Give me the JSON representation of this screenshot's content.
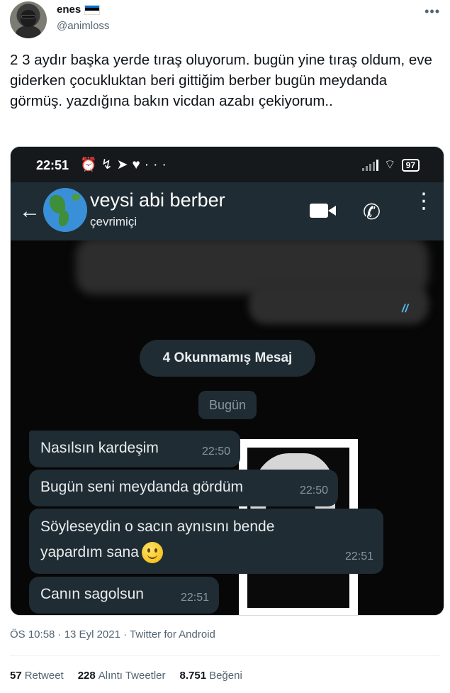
{
  "author": {
    "name": "enes",
    "handle": "@animloss",
    "flag_colors": [
      "#0072CE",
      "#000000",
      "#FFFFFF"
    ]
  },
  "tweet_text": "2 3 aydır başka yerde tıraş oluyorum. bugün yine tıraş oldum, eve giderken çocukluktan beri gittiğim berber bugün meydanda görmüş. yazdığına bakın vicdan azabı çekiyorum..",
  "phone": {
    "status_time": "22:51",
    "battery": "97"
  },
  "chat_header": {
    "contact_name": "veysi abi berber",
    "contact_status": "çevrimiçi"
  },
  "chat": {
    "unread_label": "4 Okunmamış Mesaj",
    "date_label": "Bugün",
    "messages": [
      {
        "text": "Nasılsın kardeşim",
        "time": "22:50"
      },
      {
        "text": "Bugün seni meydanda gördüm",
        "time": "22:50"
      },
      {
        "text_line1": "Söyleseydin o sacın aynısını bende",
        "text_line2": "yapardım sana",
        "time": "22:51"
      },
      {
        "text": "Canın sagolsun",
        "time": "22:51"
      }
    ]
  },
  "meta": {
    "timestamp": "ÖS 10:58 · 13 Eyl 2021 · Twitter for Android"
  },
  "stats": {
    "retweets_count": "57",
    "retweets_label": "Retweet",
    "quotes_count": "228",
    "quotes_label": "Alıntı Tweetler",
    "likes_count": "8.751",
    "likes_label": "Beğeni"
  },
  "colors": {
    "wa_bubble": "#202C33",
    "wa_header": "#202C33",
    "twitter_text": "#0F1419",
    "twitter_secondary": "#536471"
  }
}
